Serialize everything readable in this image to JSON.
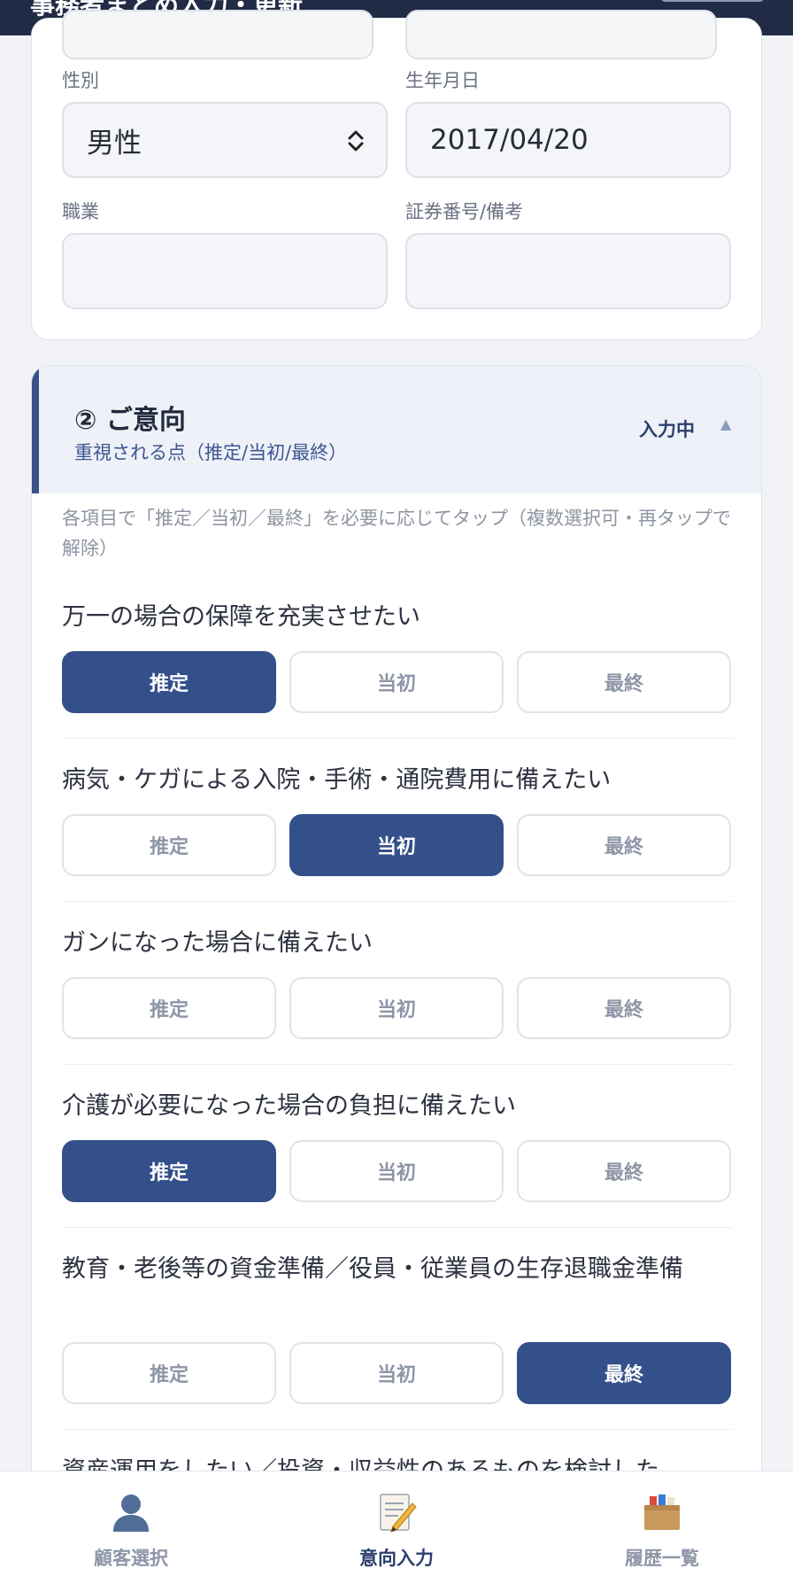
{
  "header": {
    "title": "事務者まとめ入力・更新"
  },
  "customer_form": {
    "gender": {
      "label": "性別",
      "value": "男性"
    },
    "birthdate": {
      "label": "生年月日",
      "value": "2017/04/20"
    },
    "occupation": {
      "label": "職業",
      "value": ""
    },
    "policy_note": {
      "label": "証券番号/備考",
      "value": ""
    }
  },
  "intent_section": {
    "title": "② ご意向",
    "subtitle": "重視される点（推定/当初/最終）",
    "status": "入力中",
    "hint": "各項目で「推定／当初／最終」を必要に応じてタップ（複数選択可・再タップで解除）",
    "option_labels": [
      "推定",
      "当初",
      "最終"
    ],
    "questions": [
      {
        "label": "万一の場合の保障を充実させたい",
        "selected": "推定"
      },
      {
        "label": "病気・ケガによる入院・手術・通院費用に備えたい",
        "selected": "当初"
      },
      {
        "label": "ガンになった場合に備えたい",
        "selected": ""
      },
      {
        "label": "介護が必要になった場合の負担に備えたい",
        "selected": "推定"
      },
      {
        "label": "教育・老後等の資金準備／役員・従業員の生存退職金準備",
        "selected": "最終"
      },
      {
        "label": "資産運用をしたい／投資・収益性のあるものを検討した",
        "selected": ""
      }
    ]
  },
  "bottom_nav": {
    "items": [
      {
        "label": "顧客選択",
        "icon": "person-icon",
        "active": false
      },
      {
        "label": "意向入力",
        "icon": "memo-pencil-icon",
        "active": true
      },
      {
        "label": "履歴一覧",
        "icon": "card-box-icon",
        "active": false
      }
    ]
  },
  "colors": {
    "primary": "#34508b",
    "header_bg": "#222b45",
    "accent_border": "#38538c"
  }
}
